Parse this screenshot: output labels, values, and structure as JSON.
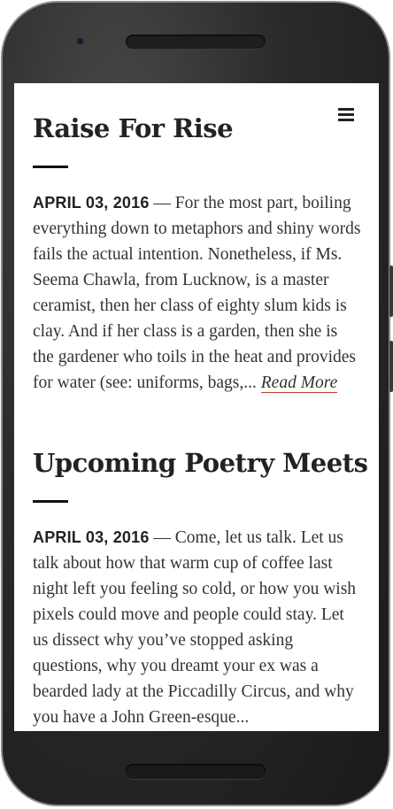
{
  "posts": [
    {
      "title": "Raise For Rise",
      "date": "APRIL 03, 2016",
      "separator": " — ",
      "excerpt": "For the most part, boiling everything down to metaphors and shiny words fails the actual intention. Nonetheless, if Ms. Seema Chawla, from Lucknow, is a master ceramist, then her class of eighty slum kids is clay. And if her class is a garden, then she is the gardener who toils in the heat and provides for water (see: uniforms, bags,... ",
      "read_more": "Read More"
    },
    {
      "title": "Upcoming Poetry Meets",
      "date": "APRIL 03, 2016",
      "separator": " — ",
      "excerpt": "Come, let us talk. Let us talk about how that warm cup of coffee last night left you feeling so cold, or how you wish pixels could move and people could stay. Let us dissect why you’ve stopped asking questions, why you dreamt your ex was a bearded lady at the Piccadilly Circus, and why you have a John Green-esque..."
    }
  ],
  "icons": {
    "menu": "hamburger-menu-icon"
  },
  "colors": {
    "accent_underline": "#c0392b",
    "text": "#333333",
    "heading": "#222222"
  }
}
